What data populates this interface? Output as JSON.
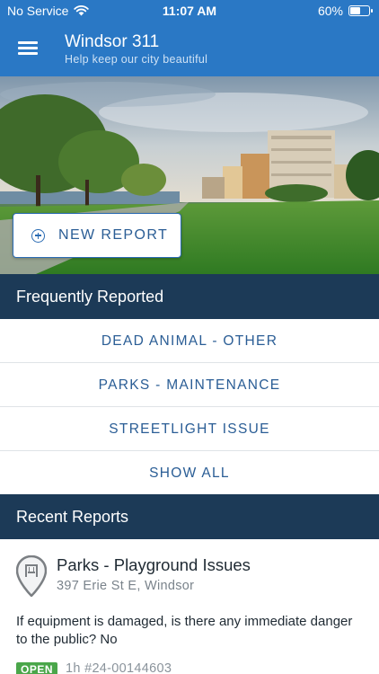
{
  "status_bar": {
    "carrier": "No Service",
    "time": "11:07 AM",
    "battery": "60%",
    "battery_level": 0.6
  },
  "header": {
    "title": "Windsor 311",
    "subtitle": "Help keep our city beautiful",
    "menu_icon": "hamburger-menu-icon"
  },
  "hero": {
    "new_report_label": "NEW REPORT",
    "new_report_icon": "plus-circle-icon"
  },
  "frequently_reported": {
    "heading": "Frequently Reported",
    "items": [
      {
        "label": "DEAD ANIMAL - OTHER"
      },
      {
        "label": "PARKS - MAINTENANCE"
      },
      {
        "label": "STREETLIGHT ISSUE"
      },
      {
        "label": "SHOW ALL"
      }
    ]
  },
  "recent_reports": {
    "heading": "Recent Reports",
    "reports": [
      {
        "icon": "map-pin-playground-icon",
        "title": "Parks - Playground Issues",
        "address": "397 Erie St E, Windsor",
        "description": "If equipment is damaged, is there any immediate danger to the public? No",
        "status": "OPEN",
        "age": "1h",
        "number": "#24-00144603"
      }
    ]
  },
  "colors": {
    "primary": "#2a78c5",
    "section": "#1c3a57",
    "link": "#2a5d95",
    "open": "#4aa64a"
  }
}
